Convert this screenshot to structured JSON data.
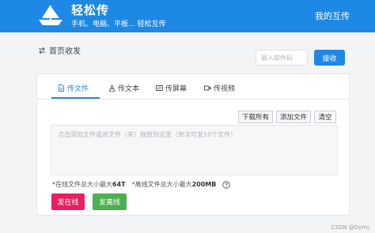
{
  "header": {
    "brand": "轻松传",
    "tagline": "手机、电脑、平板... 轻松互传",
    "my_link": "我的互传"
  },
  "breadcrumb": {
    "label": "首页收发"
  },
  "receive": {
    "placeholder": "输入取件码",
    "button_label": "接收"
  },
  "tabs": [
    {
      "label": "传文件",
      "icon": "file-icon",
      "active": true
    },
    {
      "label": "传文本",
      "icon": "text-icon",
      "active": false
    },
    {
      "label": "传屏幕",
      "icon": "screen-icon",
      "active": false
    },
    {
      "label": "传视频",
      "icon": "video-icon",
      "active": false
    }
  ],
  "actions": {
    "download_all": "下载所有",
    "add_file": "添加文件",
    "clear": "清空"
  },
  "dropzone": {
    "text": "点击添加文件或将文件（夹）拖放到这里（单次可发10个文件）"
  },
  "limits": {
    "online_prefix": "*在线文件总大小最大",
    "online_value": "64T",
    "offline_prefix": "*离线文件总大小最大",
    "offline_value": "200MB"
  },
  "send": {
    "online_label": "发在线",
    "offline_label": "发离线"
  },
  "watermark": "CSDN @Dymc",
  "colors": {
    "primary": "#1e88e5",
    "online": "#e91e63",
    "offline": "#4caf50"
  }
}
